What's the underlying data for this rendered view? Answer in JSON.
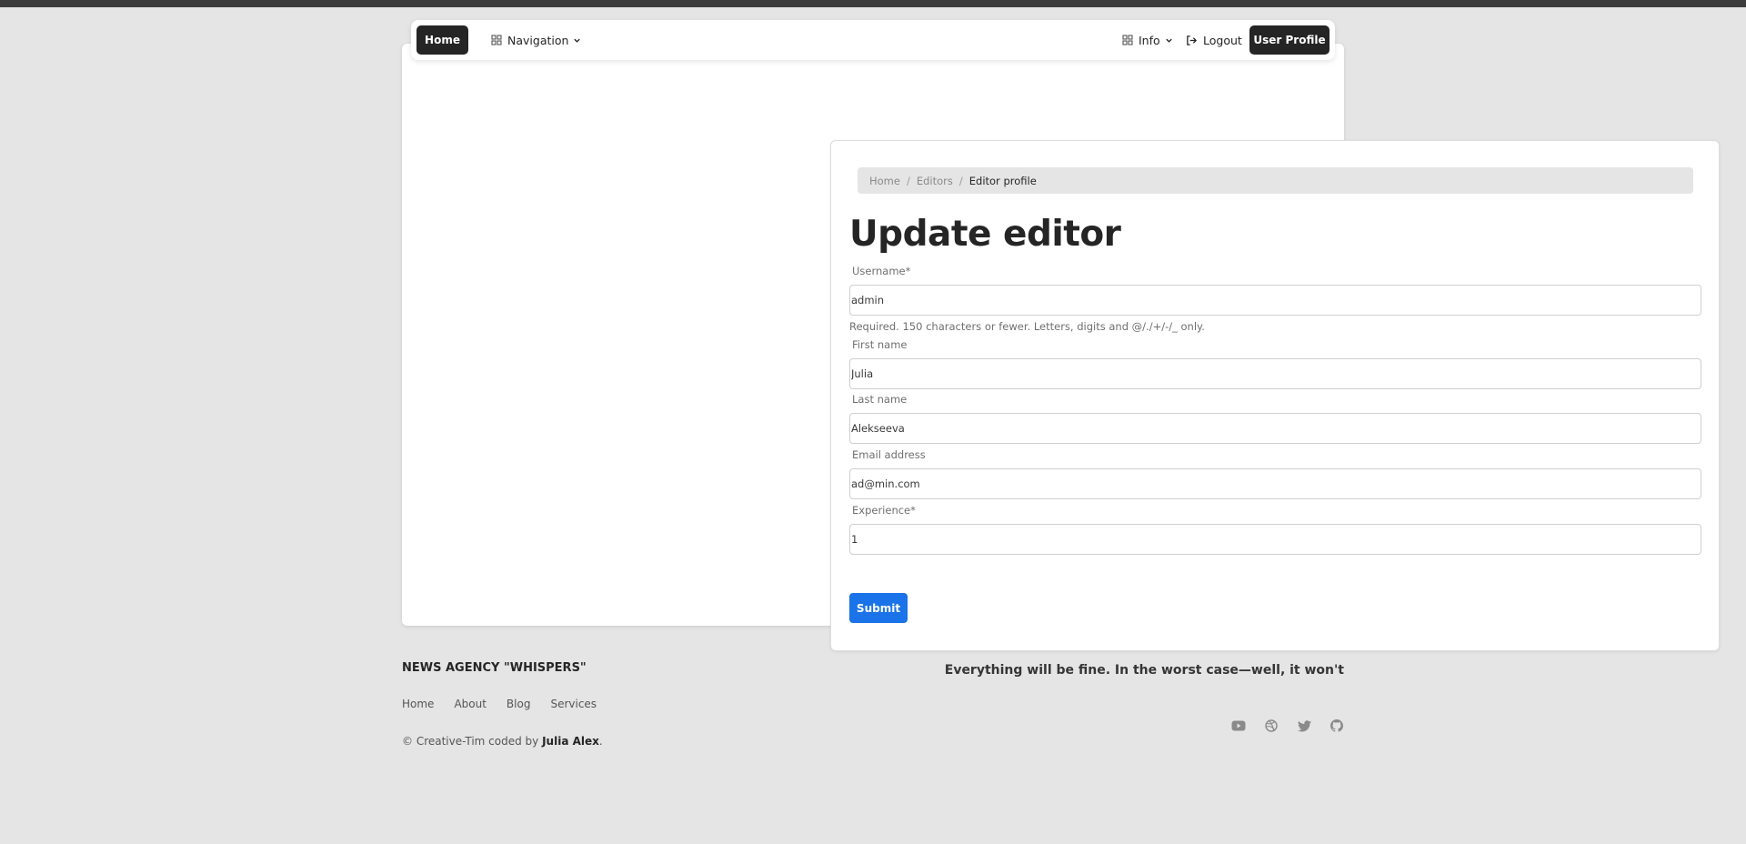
{
  "nav": {
    "home": "Home",
    "navigation": "Navigation",
    "info": "Info",
    "logout": "Logout",
    "user_profile": "User Profile"
  },
  "breadcrumb": {
    "items": [
      "Home",
      "Editors"
    ],
    "separator": "/",
    "current": "Editor profile"
  },
  "form": {
    "title": "Update editor",
    "fields": [
      {
        "label": "Username*",
        "value": "admin"
      },
      {
        "label": "First name",
        "value": "Julia"
      },
      {
        "label": "Last name",
        "value": "Alekseeva"
      },
      {
        "label": "Email address",
        "value": "ad@min.com"
      },
      {
        "label": "Experience*",
        "value": "1"
      }
    ],
    "username_help": "Required. 150 characters or fewer. Letters, digits and @/./+/-/_ only.",
    "submit": "Submit"
  },
  "footer": {
    "brand": "NEWS AGENCY \"WHISPERS\"",
    "tagline": "Everything will be fine. In the worst case—well, it won't",
    "links": [
      "Home",
      "About",
      "Blog",
      "Services"
    ],
    "copy_prefix": "© Creative-Tim coded by",
    "copy_author": "Julia Alex",
    "copy_suffix": ".",
    "socials": [
      "youtube-icon",
      "dribbble-icon",
      "twitter-icon",
      "github-icon"
    ]
  },
  "colors": {
    "accent": "#1a73e8",
    "dark": "#252525",
    "background": "#e5e5e5"
  }
}
